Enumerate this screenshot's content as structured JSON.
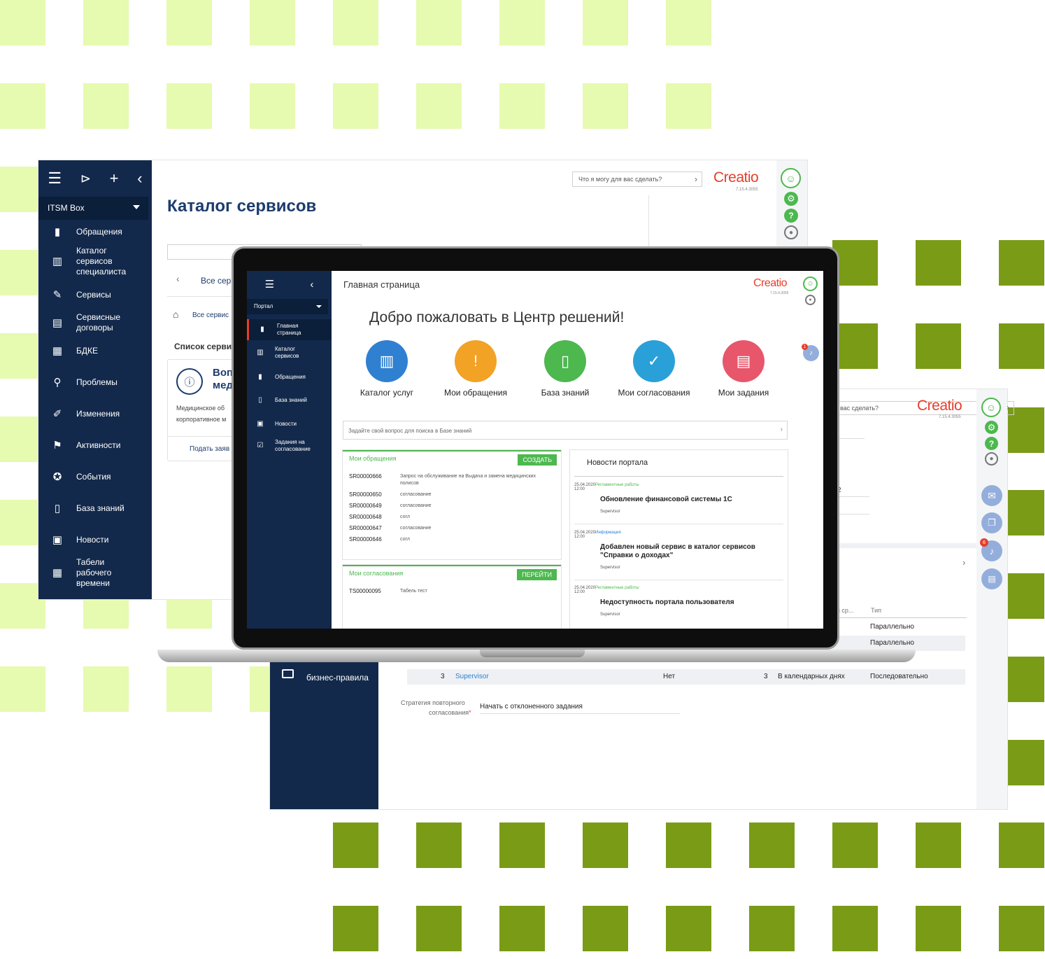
{
  "colors": {
    "navy": "#13294b",
    "creatio_red": "#e63e2b",
    "green": "#4cb84e",
    "light_square": "#e6fab0",
    "dark_square": "#7a9b16"
  },
  "left_window": {
    "tools": [
      "hamburger-icon",
      "play-icon",
      "plus-icon",
      "chevron-left-icon"
    ],
    "workspace": "ITSM Box",
    "title": "Каталог сервисов",
    "search_placeholder": "Что я могу для вас сделать?",
    "logo": "Creatio",
    "version": "7.15.4.3055",
    "tab_all": "Все серв",
    "breadcrumb": "Все сервис",
    "section_title": "Список серви",
    "card_title_1": "Воп",
    "card_title_2": "мед",
    "card_desc_1": "Медицинское об",
    "card_desc_2": "корпоративное м",
    "card_link": "Подать заяв",
    "nav": [
      {
        "label": "Обращения",
        "icon": "alert-icon"
      },
      {
        "label": "Каталог сервисов специалиста",
        "icon": "books-icon"
      },
      {
        "label": "Сервисы",
        "icon": "services-icon"
      },
      {
        "label": "Сервисные договоры",
        "icon": "contract-icon"
      },
      {
        "label": "БДКЕ",
        "icon": "cmdb-icon"
      },
      {
        "label": "Проблемы",
        "icon": "problem-icon"
      },
      {
        "label": "Изменения",
        "icon": "change-icon"
      },
      {
        "label": "Активности",
        "icon": "flag-icon"
      },
      {
        "label": "События",
        "icon": "event-icon"
      },
      {
        "label": "База знаний",
        "icon": "book-icon"
      },
      {
        "label": "Новости",
        "icon": "news-icon"
      },
      {
        "label": "Табели рабочего времени",
        "icon": "calendar-icon"
      }
    ]
  },
  "right_window": {
    "search_placeholder": "вас сделать?",
    "logo": "Creatio",
    "version": "7.15.4.3055",
    "value_fragment": "2",
    "notifications_count": "6",
    "sidebar_item": "бизнес-правила",
    "table_headers": [
      "я ср...",
      "Тип"
    ],
    "rows": [
      {
        "num": "",
        "name": "",
        "flag": "",
        "days": "",
        "unit": "",
        "type": "Параллельно"
      },
      {
        "num": "",
        "name": "",
        "flag": "",
        "days": "",
        "unit": "",
        "type": "Параллельно"
      },
      {
        "num": "",
        "name": "",
        "flag": "",
        "days": "",
        "unit": "",
        "type": "тельно"
      },
      {
        "num": "3",
        "name": "Supervisor",
        "flag": "Нет",
        "days": "3",
        "unit": "В календарных днях",
        "type": "Последовательно"
      }
    ],
    "strategy_label_1": "Стратегия повторного",
    "strategy_label_2": "согласования",
    "strategy_required": "*",
    "strategy_value": "Начать с отклоненного задания"
  },
  "laptop": {
    "workspace": "Портал",
    "header": "Главная страница",
    "logo": "Creatio",
    "version": "7.15.4.3055",
    "welcome": "Добро пожаловать в Центр решений!",
    "notifications_count": "1",
    "nav": [
      {
        "label": "Главная страница",
        "icon": "chart-icon"
      },
      {
        "label": "Каталог сервисов",
        "icon": "books-icon"
      },
      {
        "label": "Обращения",
        "icon": "alert-icon"
      },
      {
        "label": "База знаний",
        "icon": "book-icon"
      },
      {
        "label": "Новости",
        "icon": "news-icon"
      },
      {
        "label": "Задания на согласование",
        "icon": "approval-icon"
      }
    ],
    "tiles": [
      {
        "label": "Каталог услуг",
        "color": "#2f80d1",
        "icon": "books-icon"
      },
      {
        "label": "Мои обращения",
        "color": "#f2a224",
        "icon": "alert-icon"
      },
      {
        "label": "База знаний",
        "color": "#4cb84e",
        "icon": "book-icon"
      },
      {
        "label": "Мои согласования",
        "color": "#2aa0d8",
        "icon": "check-icon"
      },
      {
        "label": "Мои задания",
        "color": "#e8566b",
        "icon": "clipboard-icon"
      }
    ],
    "kb_search": "Задайте свой вопрос для поиска в Базе знаний",
    "requests": {
      "title": "Мои обращения",
      "button": "СОЗДАТЬ",
      "items": [
        {
          "id": "SR00000666",
          "text": "Запрос на обслуживание на Выдача и замена медицинских полисов"
        },
        {
          "id": "SR00000650",
          "text": "согласование"
        },
        {
          "id": "SR00000649",
          "text": "согласование"
        },
        {
          "id": "SR00000648",
          "text": "согл"
        },
        {
          "id": "SR00000647",
          "text": "согласование"
        },
        {
          "id": "SR00000646",
          "text": "согл"
        }
      ]
    },
    "approvals": {
      "title": "Мои согласования",
      "button": "ПЕРЕЙТИ",
      "items": [
        {
          "id": "TS00000095",
          "text": "Табель тест"
        }
      ]
    },
    "news": {
      "title": "Новости портала",
      "items": [
        {
          "date": "25.04.2020",
          "time": "12:00",
          "category": "Регламентные работы",
          "title": "Обновление финансовой системы 1С",
          "author": "Supervisor"
        },
        {
          "date": "25.04.2020",
          "time": "12:00",
          "category": "Информация",
          "title": "Добавлен новый сервис в каталог сервисов \"Справки о доходах\"",
          "author": "Supervisor"
        },
        {
          "date": "25.04.2020",
          "time": "12:00",
          "category": "Регламентные работы",
          "title": "Недоступность портала пользователя",
          "author": "Supervisor"
        }
      ]
    }
  }
}
